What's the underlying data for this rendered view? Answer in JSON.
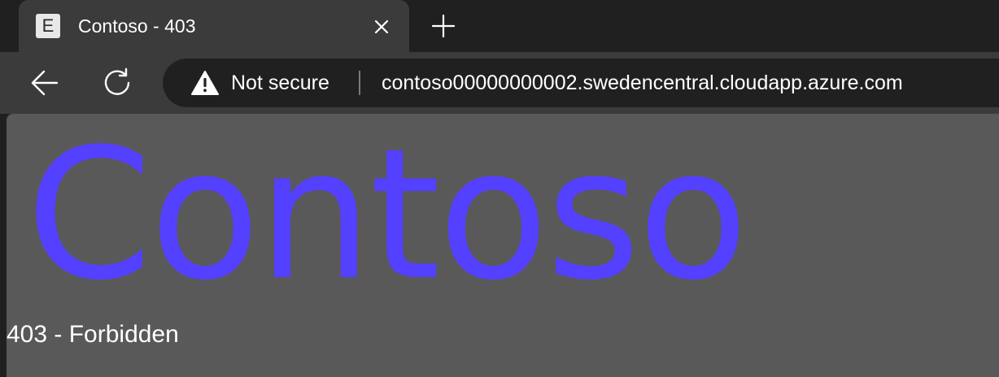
{
  "tab": {
    "favicon_letter": "E",
    "title": "Contoso - 403",
    "close_icon": "close-icon"
  },
  "new_tab_icon": "plus-icon",
  "toolbar": {
    "back_icon": "back-arrow-icon",
    "refresh_icon": "refresh-icon",
    "security": {
      "icon": "warning-icon",
      "label": "Not secure"
    },
    "url": "contoso00000000002.swedencentral.cloudapp.azure.com"
  },
  "page": {
    "brand": "Contoso",
    "brand_color": "#5440ff",
    "status": "403 - Forbidden"
  }
}
